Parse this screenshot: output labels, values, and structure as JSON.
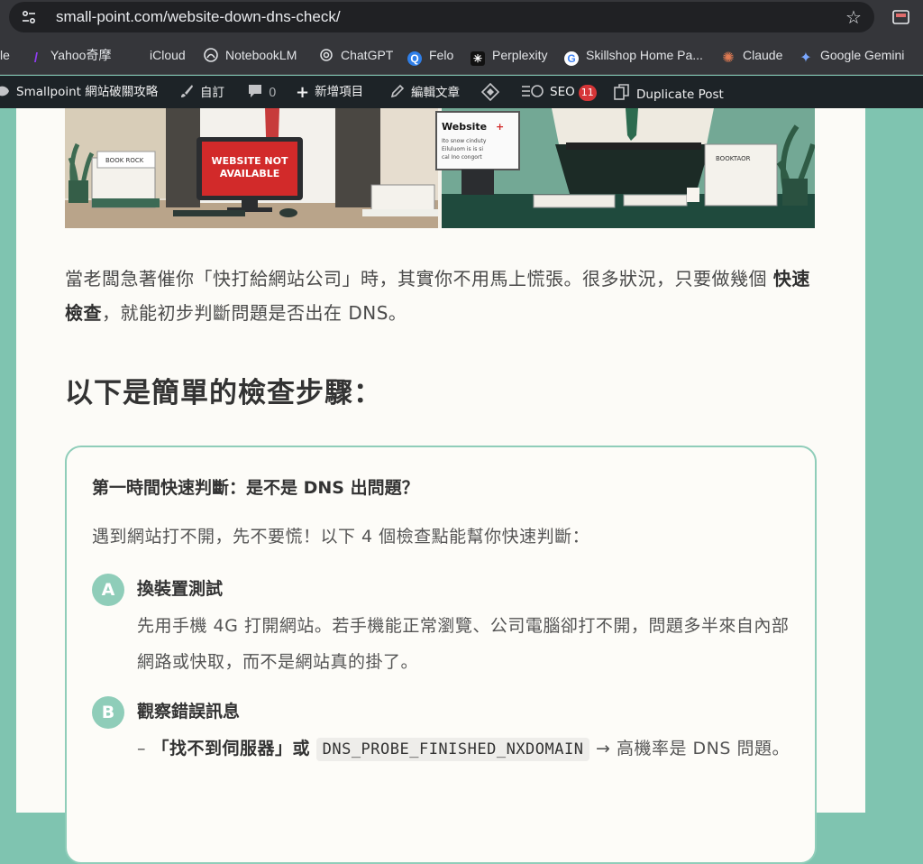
{
  "browser": {
    "url": "small-point.com/website-down-dns-check/",
    "bookmarks": [
      {
        "label": "le",
        "icon": "google-icon"
      },
      {
        "label": "Yahoo奇摩",
        "icon": "yahoo-icon"
      },
      {
        "label": "iCloud",
        "icon": "apple-icon"
      },
      {
        "label": "NotebookLM",
        "icon": "notebooklm-icon"
      },
      {
        "label": "ChatGPT",
        "icon": "chatgpt-icon"
      },
      {
        "label": "Felo",
        "icon": "felo-icon"
      },
      {
        "label": "Perplexity",
        "icon": "perplexity-icon"
      },
      {
        "label": "Skillshop Home Pa...",
        "icon": "google-icon"
      },
      {
        "label": "Claude",
        "icon": "claude-icon"
      },
      {
        "label": "Google Gemini",
        "icon": "gemini-icon"
      }
    ]
  },
  "adminbar": {
    "site_name": "Smallpoint 網站破關攻略",
    "customize": "自訂",
    "comments_count": "0",
    "new_item": "新增項目",
    "edit_post": "編輯文章",
    "seo_label": "SEO",
    "seo_count": "11",
    "duplicate_post": "Duplicate Post"
  },
  "hero": {
    "screen_text_line1": "WEBSITE NOT",
    "screen_text_line2": "AVAILABLE",
    "sign_title": "Website",
    "sign_lines": [
      "Ito snow cinduty",
      "Eiluluom is is si",
      "cal Ino congort"
    ],
    "paper_left": "BOOK ROCK",
    "paper_right": "BOOKTAOR"
  },
  "article": {
    "intro_part1": "當老闆急著催你「快打給網站公司」時，其實你不用馬上慌張。很多狀況，只要做幾個 ",
    "intro_strong": "快速檢查",
    "intro_part2": "，就能初步判斷問題是否出在 DNS。",
    "heading": "以下是簡單的檢查步驟：",
    "card": {
      "title": "第一時間快速判斷：是不是 DNS 出問題？",
      "lead": "遇到網站打不開，先不要慌！以下 4 個檢查點能幫你快速判斷：",
      "steps": [
        {
          "badge": "A",
          "title": "換裝置測試",
          "body": "先用手機 4G 打開網站。若手機能正常瀏覽、公司電腦卻打不開，問題多半來自內部網路或快取，而不是網站真的掛了。"
        },
        {
          "badge": "B",
          "title": "觀察錯誤訊息",
          "body_prefix": "–",
          "body_quote": "「找不到伺服器」或",
          "body_code": "DNS_PROBE_FINISHED_NXDOMAIN",
          "body_suffix": "→ 高機率是 DNS 問題。"
        }
      ]
    }
  },
  "colors": {
    "page_bg": "#7fc4b0",
    "accent": "#8fcdb9",
    "admin_bar": "#1d2327",
    "browser_chrome": "#35363a"
  }
}
